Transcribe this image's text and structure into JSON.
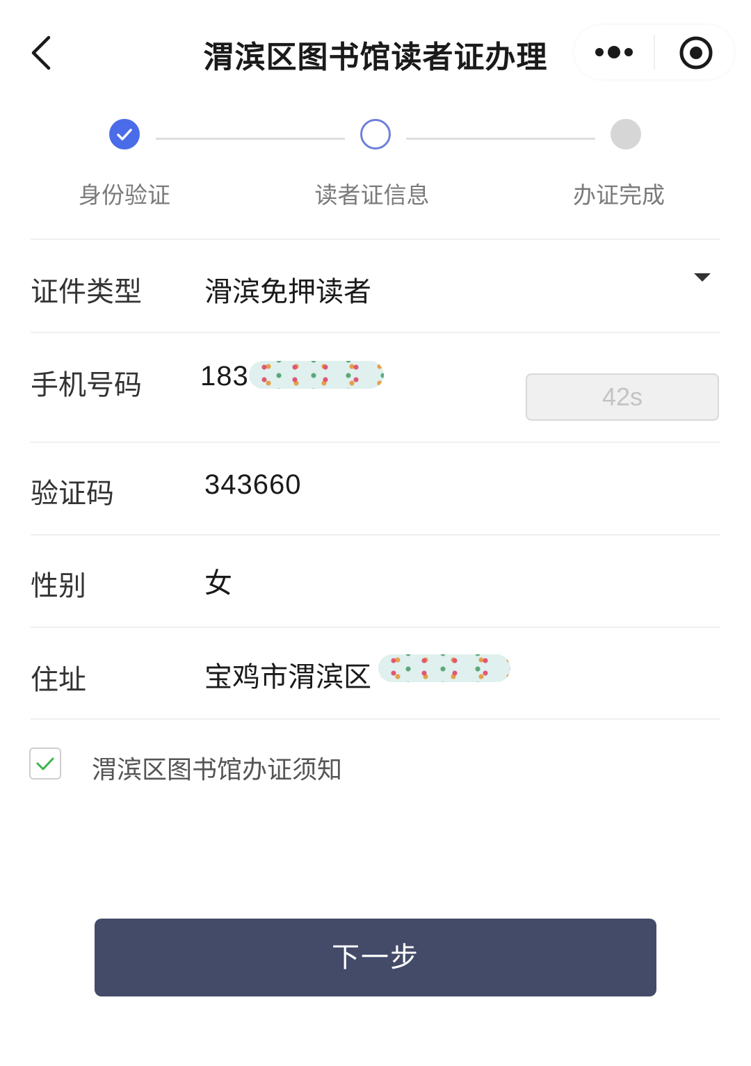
{
  "header": {
    "title": "渭滨区图书馆读者证办理",
    "back_icon": "chevron-left-icon",
    "more_icon": "more-dots-icon",
    "close_icon": "record-circle-icon"
  },
  "steps": [
    {
      "label": "身份验证",
      "state": "done"
    },
    {
      "label": "读者证信息",
      "state": "current"
    },
    {
      "label": "办证完成",
      "state": "pending"
    }
  ],
  "form": {
    "card_type": {
      "label": "证件类型",
      "value": "滑滨免押读者"
    },
    "phone": {
      "label": "手机号码",
      "value": "183",
      "code_button": "42s"
    },
    "verify_code": {
      "label": "验证码",
      "value": "343660"
    },
    "gender": {
      "label": "性别",
      "value": "女"
    },
    "address": {
      "label": "住址",
      "value": "宝鸡市渭滨区"
    }
  },
  "agreement": {
    "checked": true,
    "label": "渭滨区图书馆办证须知"
  },
  "next_button": {
    "label": "下一步"
  },
  "colors": {
    "accent": "#4a6ce8",
    "button": "#434b68",
    "check": "#3bb54a"
  }
}
